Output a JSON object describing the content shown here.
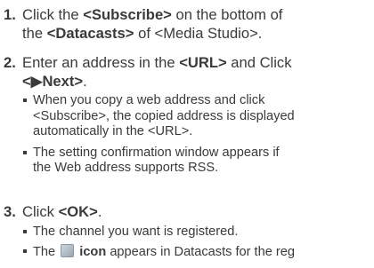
{
  "steps": [
    {
      "num": "1.",
      "line1_a": "Click the ",
      "line1_b": "<Subscribe>",
      "line1_c": " on the bottom of",
      "line2_a": "the ",
      "line2_b": "<Datacasts>",
      "line2_c": " of <Media Studio>."
    },
    {
      "num": "2.",
      "line1_a": "Enter an address in the ",
      "line1_b": "<URL>",
      "line1_c": " and Click",
      "line2_b": "<▶Next>",
      "line2_c": ".",
      "bullets": [
        {
          "l1": "When you copy a web address and click",
          "l2": "<Subscribe>, the copied address is displayed",
          "l3": "automatically in the <URL>."
        },
        {
          "l1": "The setting confirmation window appears if",
          "l2": "the Web address supports RSS."
        }
      ]
    },
    {
      "num": "3.",
      "line1_a": "Click ",
      "line1_b": "<OK>",
      "line1_c": ".",
      "bullets": [
        {
          "l1": "The channel you want is registered."
        },
        {
          "l1_a": "The ",
          "icon": "rss-channel-icon",
          "l1_b": "icon",
          "l1_c": " appears in Datacasts for the reg"
        }
      ]
    }
  ]
}
